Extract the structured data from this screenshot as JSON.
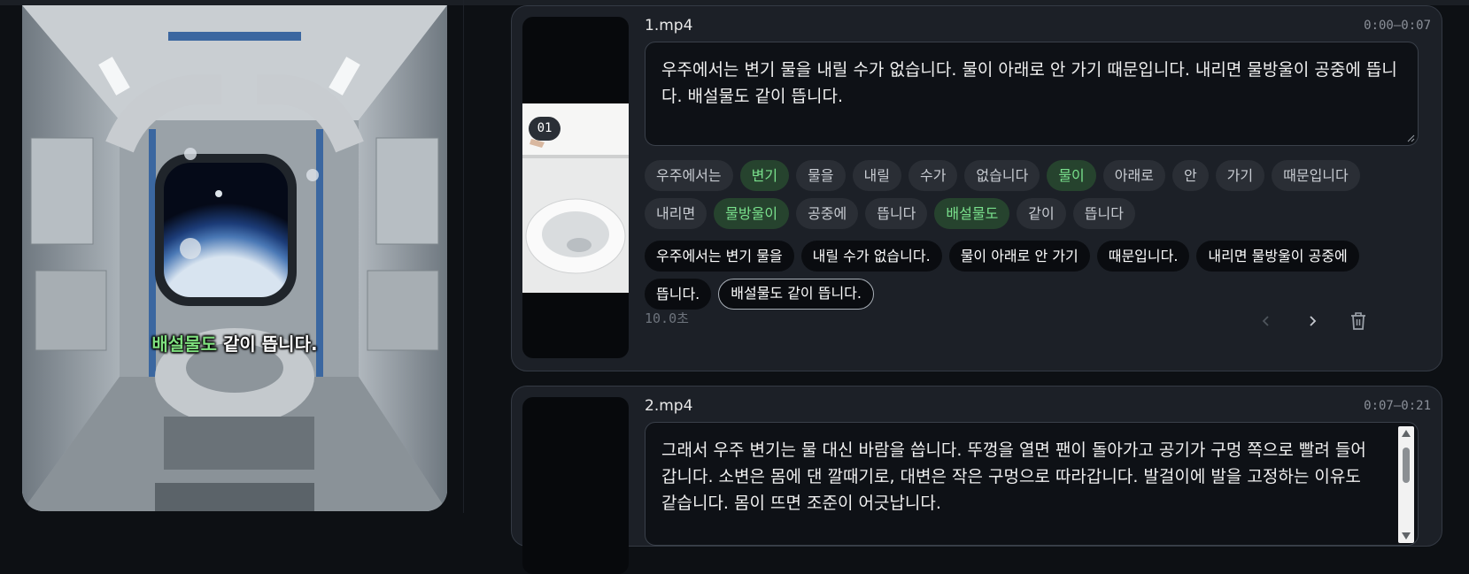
{
  "preview": {
    "subtitle_highlight": "배설물도",
    "subtitle_rest": "같이 뜹니다."
  },
  "clips": [
    {
      "filename": "1.mp4",
      "time_range": "0:00–0:07",
      "badge": "01",
      "text": "우주에서는 변기 물을 내릴 수가 없습니다. 물이 아래로 안 가기 때문입니다. 내리면 물방울이 공중에 뜹니다. 배설물도 같이 뜹니다.",
      "words": [
        {
          "text": "우주에서는",
          "highlighted": false
        },
        {
          "text": "변기",
          "highlighted": true
        },
        {
          "text": "물을",
          "highlighted": false
        },
        {
          "text": "내릴",
          "highlighted": false
        },
        {
          "text": "수가",
          "highlighted": false
        },
        {
          "text": "없습니다",
          "highlighted": false
        },
        {
          "text": "물이",
          "highlighted": true
        },
        {
          "text": "아래로",
          "highlighted": false
        },
        {
          "text": "안",
          "highlighted": false
        },
        {
          "text": "가기",
          "highlighted": false
        },
        {
          "text": "때문입니다",
          "highlighted": false
        },
        {
          "text": "내리면",
          "highlighted": false
        },
        {
          "text": "물방울이",
          "highlighted": true
        },
        {
          "text": "공중에",
          "highlighted": false
        },
        {
          "text": "뜹니다",
          "highlighted": false
        },
        {
          "text": "배설물도",
          "highlighted": true
        },
        {
          "text": "같이",
          "highlighted": false
        },
        {
          "text": "뜹니다",
          "highlighted": false
        }
      ],
      "phrases": [
        {
          "text": "우주에서는 변기 물을",
          "selected": false
        },
        {
          "text": "내릴 수가 없습니다.",
          "selected": false
        },
        {
          "text": "물이 아래로 안 가기",
          "selected": false
        },
        {
          "text": "때문입니다.",
          "selected": false
        },
        {
          "text": "내리면 물방울이 공중에",
          "selected": false
        },
        {
          "text": "뜹니다.",
          "selected": false
        },
        {
          "text": "배설물도 같이 뜹니다.",
          "selected": true
        }
      ],
      "duration": "10.0초"
    },
    {
      "filename": "2.mp4",
      "time_range": "0:07–0:21",
      "text": "그래서 우주 변기는 물 대신 바람을 씁니다. 뚜껑을 열면 팬이 돌아가고 공기가 구멍 쪽으로 빨려 들어갑니다. 소변은 몸에 댄 깔때기로, 대변은 작은 구멍으로 따라갑니다. 발걸이에 발을 고정하는 이유도 같습니다. 몸이 뜨면 조준이 어긋납니다."
    }
  ],
  "colors": {
    "highlight_green": "#79e08c",
    "card_bg": "#1c2027",
    "page_bg": "#0d1014"
  }
}
